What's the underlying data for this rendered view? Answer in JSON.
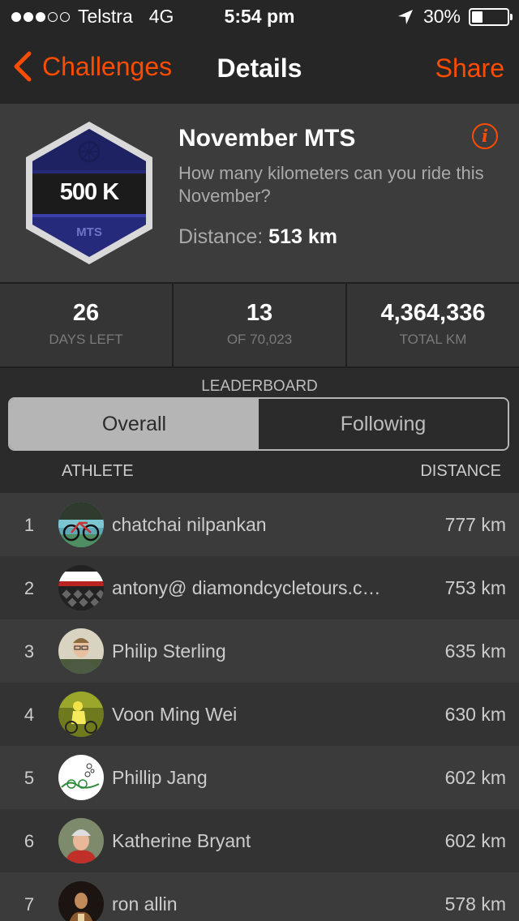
{
  "status_bar": {
    "signal_dots": [
      true,
      true,
      true,
      false,
      false
    ],
    "carrier": "Telstra",
    "network": "4G",
    "time": "5:54 pm",
    "battery": "30%",
    "battery_level": 0.3
  },
  "nav": {
    "back_label": "Challenges",
    "title": "Details",
    "share_label": "Share",
    "accent_color": "#fc4c02"
  },
  "challenge": {
    "badge_label": "500 K",
    "badge_subtitle": "MTS",
    "title": "November MTS",
    "description": "How many kilometers can you ride this November?",
    "distance_label": "Distance:",
    "distance_value": "513 km",
    "info_icon": "i"
  },
  "stats": [
    {
      "value": "26",
      "label": "DAYS LEFT"
    },
    {
      "value": "13",
      "label": "OF 70,023"
    },
    {
      "value": "4,364,336",
      "label": "TOTAL KM"
    }
  ],
  "leaderboard": {
    "title": "LEADERBOARD",
    "tabs": [
      {
        "label": "Overall",
        "selected": true
      },
      {
        "label": "Following",
        "selected": false
      }
    ],
    "column_athlete": "ATHLETE",
    "column_distance": "DISTANCE",
    "rows": [
      {
        "rank": "1",
        "name": "chatchai nilpankan",
        "distance": "777 km",
        "avatar": "bike-photo"
      },
      {
        "rank": "2",
        "name": "antony@ diamondcycletours.com",
        "distance": "753 km",
        "avatar": "diamond-logo"
      },
      {
        "rank": "3",
        "name": "Philip  Sterling",
        "distance": "635 km",
        "avatar": "person-photo"
      },
      {
        "rank": "4",
        "name": "Voon Ming Wei",
        "distance": "630 km",
        "avatar": "cyclist-photo"
      },
      {
        "rank": "5",
        "name": "Phillip Jang",
        "distance": "602 km",
        "avatar": "drawing"
      },
      {
        "rank": "6",
        "name": "Katherine Bryant",
        "distance": "602 km",
        "avatar": "helmet-photo"
      },
      {
        "rank": "7",
        "name": "ron allin",
        "distance": "578 km",
        "avatar": "person-photo-dark"
      }
    ]
  }
}
